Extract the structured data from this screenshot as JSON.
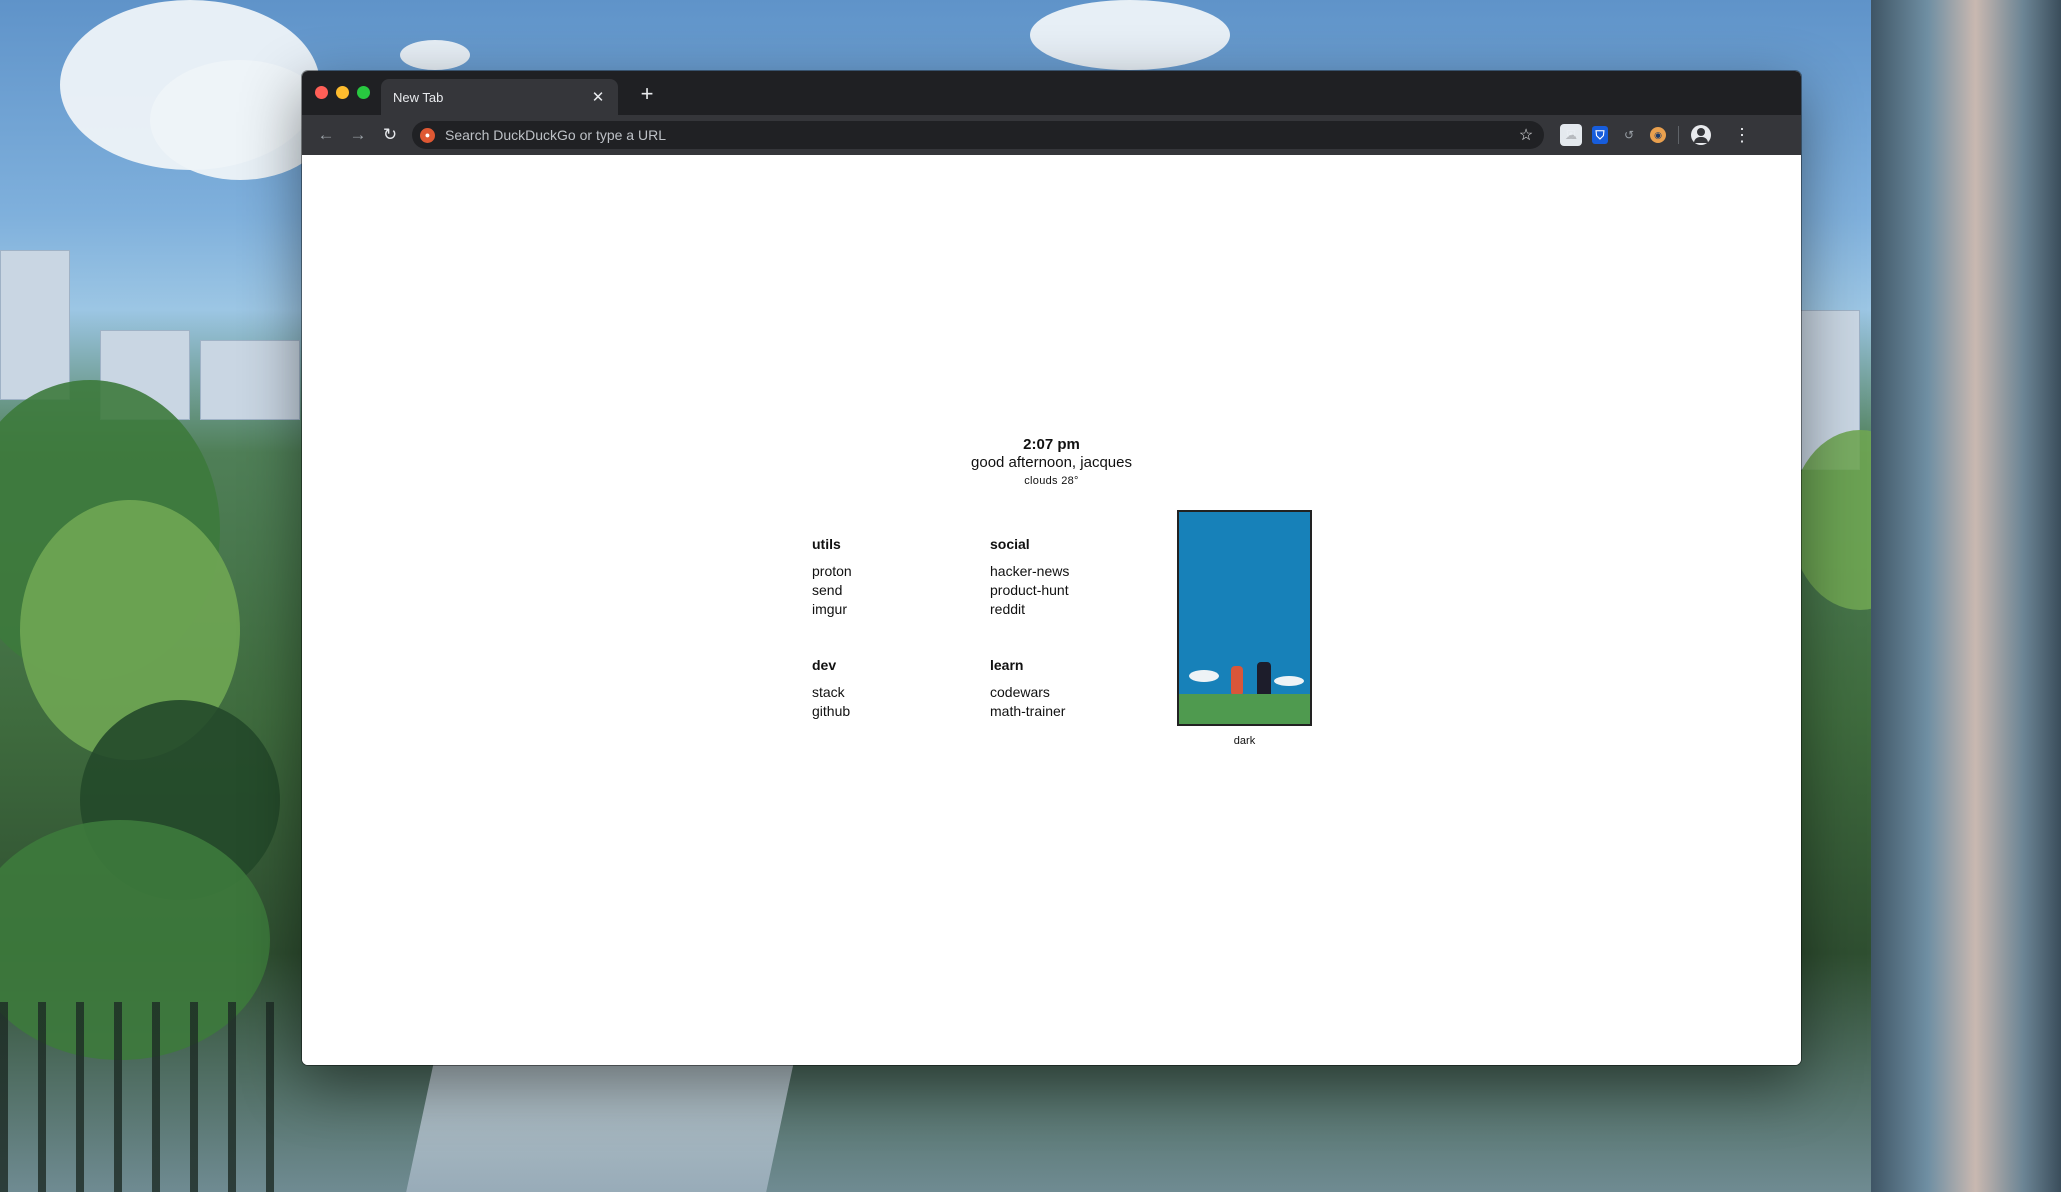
{
  "browser": {
    "tab_title": "New Tab",
    "tab_close": "✕",
    "new_tab": "+",
    "omnibox_placeholder": "Search DuckDuckGo or type a URL",
    "omnibox_value": "",
    "back_glyph": "←",
    "forward_glyph": "→",
    "reload_glyph": "↻",
    "star_glyph": "☆",
    "menu_glyph": "⋮",
    "extensions": [
      "shield-icon",
      "cloud-icon",
      "bitwarden-icon",
      "history-icon",
      "octotree-icon"
    ]
  },
  "startpage": {
    "time": "2:07 pm",
    "greeting": "good afternoon, jacques",
    "weather": "clouds 28°",
    "groups": [
      {
        "title": "utils",
        "links": [
          "proton",
          "send",
          "imgur"
        ]
      },
      {
        "title": "social",
        "links": [
          "hacker-news",
          "product-hunt",
          "reddit"
        ]
      },
      {
        "title": "dev",
        "links": [
          "stack",
          "github"
        ]
      },
      {
        "title": "learn",
        "links": [
          "codewars",
          "math-trainer"
        ]
      }
    ],
    "theme_label": "dark"
  },
  "colors": {
    "tabstrip": "#1f2023",
    "toolbar": "#35363a",
    "omnibox": "#202124",
    "preview_sky": "#1781b9"
  }
}
